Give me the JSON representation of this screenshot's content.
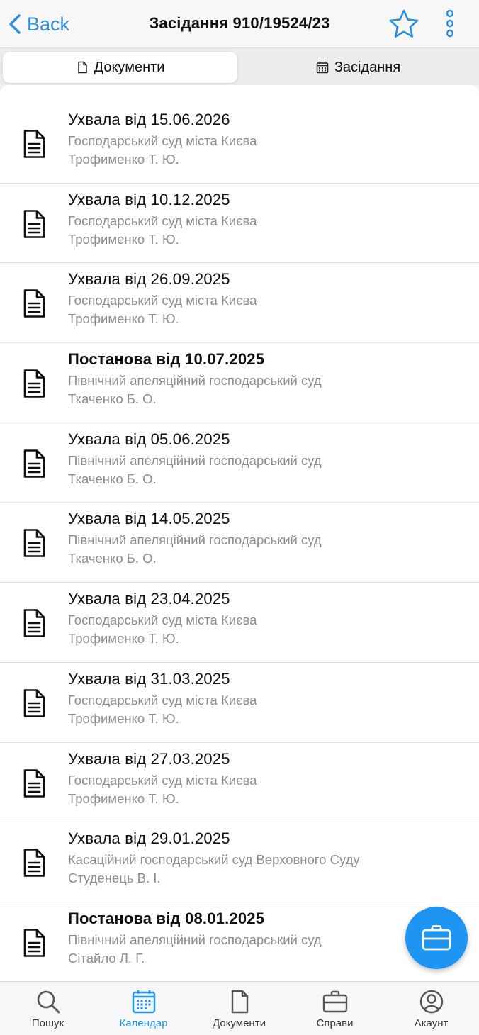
{
  "header": {
    "back_label": "Back",
    "title": "Засідання 910/19524/23"
  },
  "tabs": [
    {
      "label": "Документи",
      "active": true
    },
    {
      "label": "Засідання",
      "active": false
    }
  ],
  "documents": [
    {
      "title": "Ухвала від 15.06.2026",
      "court": "Господарський суд міста Києва",
      "judge": "Трофименко Т. Ю.",
      "bold": false
    },
    {
      "title": "Ухвала від 10.12.2025",
      "court": "Господарський суд міста Києва",
      "judge": "Трофименко Т. Ю.",
      "bold": false
    },
    {
      "title": "Ухвала від 26.09.2025",
      "court": "Господарський суд міста Києва",
      "judge": "Трофименко Т. Ю.",
      "bold": false
    },
    {
      "title": "Постанова від 10.07.2025",
      "court": "Північний апеляційний господарський суд",
      "judge": "Ткаченко Б. О.",
      "bold": true
    },
    {
      "title": "Ухвала від 05.06.2025",
      "court": "Північний апеляційний господарський суд",
      "judge": "Ткаченко Б. О.",
      "bold": false
    },
    {
      "title": "Ухвала від 14.05.2025",
      "court": "Північний апеляційний господарський суд",
      "judge": "Ткаченко Б. О.",
      "bold": false
    },
    {
      "title": "Ухвала від 23.04.2025",
      "court": "Господарський суд міста Києва",
      "judge": "Трофименко Т. Ю.",
      "bold": false
    },
    {
      "title": "Ухвала від 31.03.2025",
      "court": "Господарський суд міста Києва",
      "judge": "Трофименко Т. Ю.",
      "bold": false
    },
    {
      "title": "Ухвала від 27.03.2025",
      "court": "Господарський суд міста Києва",
      "judge": "Трофименко Т. Ю.",
      "bold": false
    },
    {
      "title": "Ухвала від 29.01.2025",
      "court": "Касаційний господарський суд Верховного Суду",
      "judge": "Студенець В. І.",
      "bold": false
    },
    {
      "title": "Постанова від 08.01.2025",
      "court": "Північний апеляційний господарський суд",
      "judge": "Сітайло Л. Г.",
      "bold": true
    }
  ],
  "bottom_nav": [
    {
      "label": "Пошук",
      "icon": "search-icon",
      "active": false
    },
    {
      "label": "Календар",
      "icon": "calendar-icon",
      "active": true
    },
    {
      "label": "Документи",
      "icon": "document-icon",
      "active": false
    },
    {
      "label": "Справи",
      "icon": "briefcase-icon",
      "active": false
    },
    {
      "label": "Акаунт",
      "icon": "account-icon",
      "active": false
    }
  ],
  "colors": {
    "accent": "#1e95f2",
    "link": "#2e8fe0",
    "secondary_text": "#8d8d8d"
  }
}
